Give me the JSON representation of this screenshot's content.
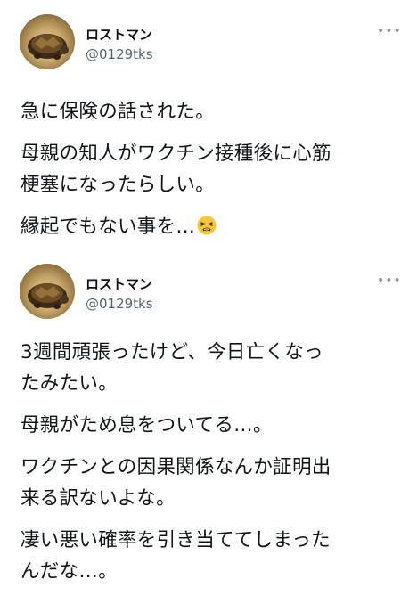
{
  "tweets": [
    {
      "author": {
        "name": "ロストマン",
        "handle": "@0129tks"
      },
      "more_icon": "more-horizontal-icon",
      "paragraphs": [
        "急に保険の話された。",
        "母親の知人がワクチン接種後に心筋\n梗塞になったらしい。",
        "縁起でもない事を…"
      ],
      "trailing_emoji": "tired-face-emoji"
    },
    {
      "author": {
        "name": "ロストマン",
        "handle": "@0129tks"
      },
      "more_icon": "more-horizontal-icon",
      "paragraphs": [
        "3週間頑張ったけど、今日亡くなっ\nたみたい。",
        "母親がため息をついてる…。",
        "ワクチンとの因果関係なんか証明出\n来る訳ないよな。",
        "凄い悪い確率を引き当ててしまった\nんだな…。"
      ]
    }
  ],
  "colors": {
    "text": "#0f1419",
    "secondary": "#536471",
    "background": "#ffffff"
  }
}
